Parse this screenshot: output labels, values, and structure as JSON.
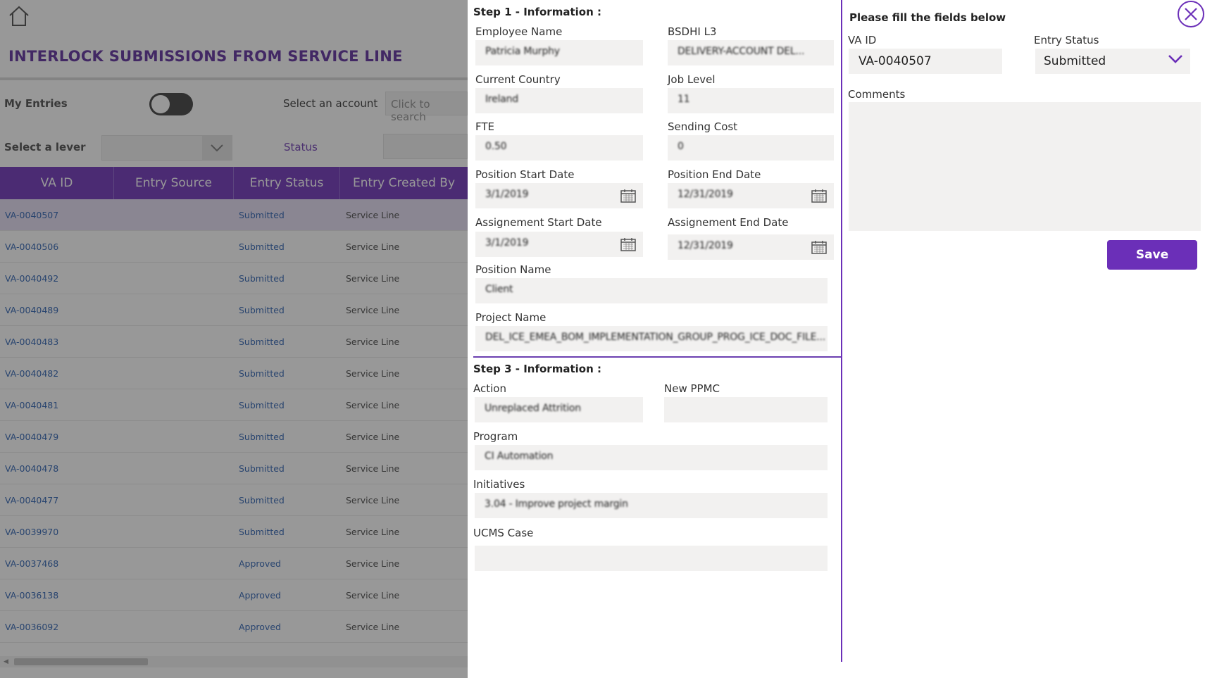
{
  "app": {
    "title": "INTERLOCK SUBMISSIONS FROM SERVICE LINE",
    "home_icon": "home-icon"
  },
  "filters": {
    "my_entries_label": "My Entries",
    "my_entries_on": false,
    "account_label": "Select an account",
    "account_placeholder": "Click to search",
    "lever_label": "Select a lever",
    "status_label": "Status"
  },
  "grid": {
    "columns": [
      "VA ID",
      "Entry Source",
      "Entry Status",
      "Entry Created By"
    ],
    "rows": [
      {
        "va_id": "VA-0040507",
        "source": "",
        "status": "Submitted",
        "created_by": "Service Line",
        "selected": true
      },
      {
        "va_id": "VA-0040506",
        "source": "",
        "status": "Submitted",
        "created_by": "Service Line"
      },
      {
        "va_id": "VA-0040492",
        "source": "",
        "status": "Submitted",
        "created_by": "Service Line"
      },
      {
        "va_id": "VA-0040489",
        "source": "",
        "status": "Submitted",
        "created_by": "Service Line"
      },
      {
        "va_id": "VA-0040483",
        "source": "",
        "status": "Submitted",
        "created_by": "Service Line"
      },
      {
        "va_id": "VA-0040482",
        "source": "",
        "status": "Submitted",
        "created_by": "Service Line"
      },
      {
        "va_id": "VA-0040481",
        "source": "",
        "status": "Submitted",
        "created_by": "Service Line"
      },
      {
        "va_id": "VA-0040479",
        "source": "",
        "status": "Submitted",
        "created_by": "Service Line"
      },
      {
        "va_id": "VA-0040478",
        "source": "",
        "status": "Submitted",
        "created_by": "Service Line"
      },
      {
        "va_id": "VA-0040477",
        "source": "",
        "status": "Submitted",
        "created_by": "Service Line"
      },
      {
        "va_id": "VA-0039970",
        "source": "",
        "status": "Submitted",
        "created_by": "Service Line"
      },
      {
        "va_id": "VA-0037468",
        "source": "",
        "status": "Approved",
        "created_by": "Service Line"
      },
      {
        "va_id": "VA-0036138",
        "source": "",
        "status": "Approved",
        "created_by": "Service Line"
      },
      {
        "va_id": "VA-0036092",
        "source": "",
        "status": "Approved",
        "created_by": "Service Line"
      }
    ]
  },
  "detail": {
    "step1_title": "Step 1 - Information :",
    "employee_name_label": "Employee Name",
    "employee_name_value": "Patricia Murphy",
    "bsdhi_label": "BSDHI L3",
    "bsdhi_value": "DELIVERY-ACCOUNT DEL...",
    "country_label": "Current Country",
    "country_value": "Ireland",
    "job_level_label": "Job Level",
    "job_level_value": "11",
    "fte_label": "FTE",
    "fte_value": "0.50",
    "sending_cost_label": "Sending Cost",
    "sending_cost_value": "0",
    "pos_start_label": "Position Start Date",
    "pos_start_value": "3/1/2019",
    "pos_end_label": "Position End Date",
    "pos_end_value": "12/31/2019",
    "asg_start_label": "Assignement Start Date",
    "asg_start_value": "3/1/2019",
    "asg_end_label": "Assignement End Date",
    "asg_end_value": "12/31/2019",
    "position_name_label": "Position Name",
    "position_name_value": "Client",
    "project_name_label": "Project Name",
    "project_name_value": "DEL_ICE_EMEA_BOM_IMPLEMENTATION_GROUP_PROG_ICE_DOC_FILE...",
    "step3_title": "Step 3 - Information :",
    "action_label": "Action",
    "action_value": "Unreplaced Attrition",
    "new_ppmc_label": "New PPMC",
    "new_ppmc_value": "",
    "program_label": "Program",
    "program_value": "CI Automation",
    "initiatives_label": "Initiatives",
    "initiatives_value": "3.04 - Improve project margin",
    "ucms_label": "UCMS Case",
    "ucms_value": ""
  },
  "review": {
    "heading": "Please fill the fields below",
    "va_id_label": "VA ID",
    "va_id_value": "VA-0040507",
    "entry_status_label": "Entry Status",
    "entry_status_value": "Submitted",
    "comments_label": "Comments",
    "comments_value": "",
    "save_label": "Save"
  },
  "colors": {
    "accent": "#6b2fb8",
    "link": "#2a5fb0",
    "field_bg": "#f2f1f0"
  }
}
